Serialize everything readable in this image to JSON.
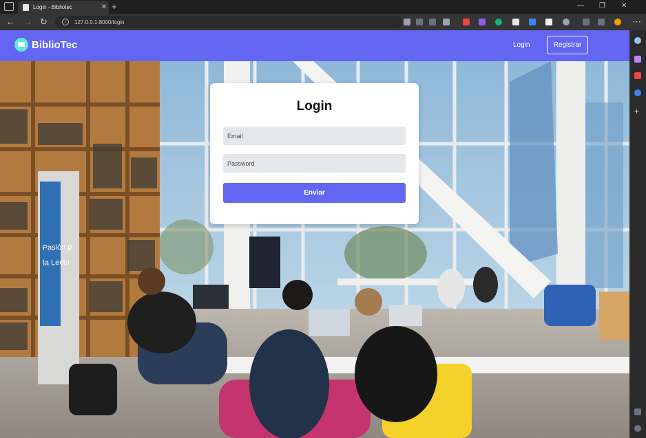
{
  "browser": {
    "tab_title": "Login - Bibliotec",
    "url": "127.0.0.1:8000/login"
  },
  "navbar": {
    "brand": "BiblioTec",
    "login_label": "Login",
    "register_label": "Registrar",
    "color": "#6366f1"
  },
  "form": {
    "title": "Login",
    "email_placeholder": "Email",
    "password_placeholder": "Password",
    "submit_label": "Enviar"
  },
  "background": {
    "sign_text_1": "Pasión p",
    "sign_text_2": "la Lectu"
  }
}
